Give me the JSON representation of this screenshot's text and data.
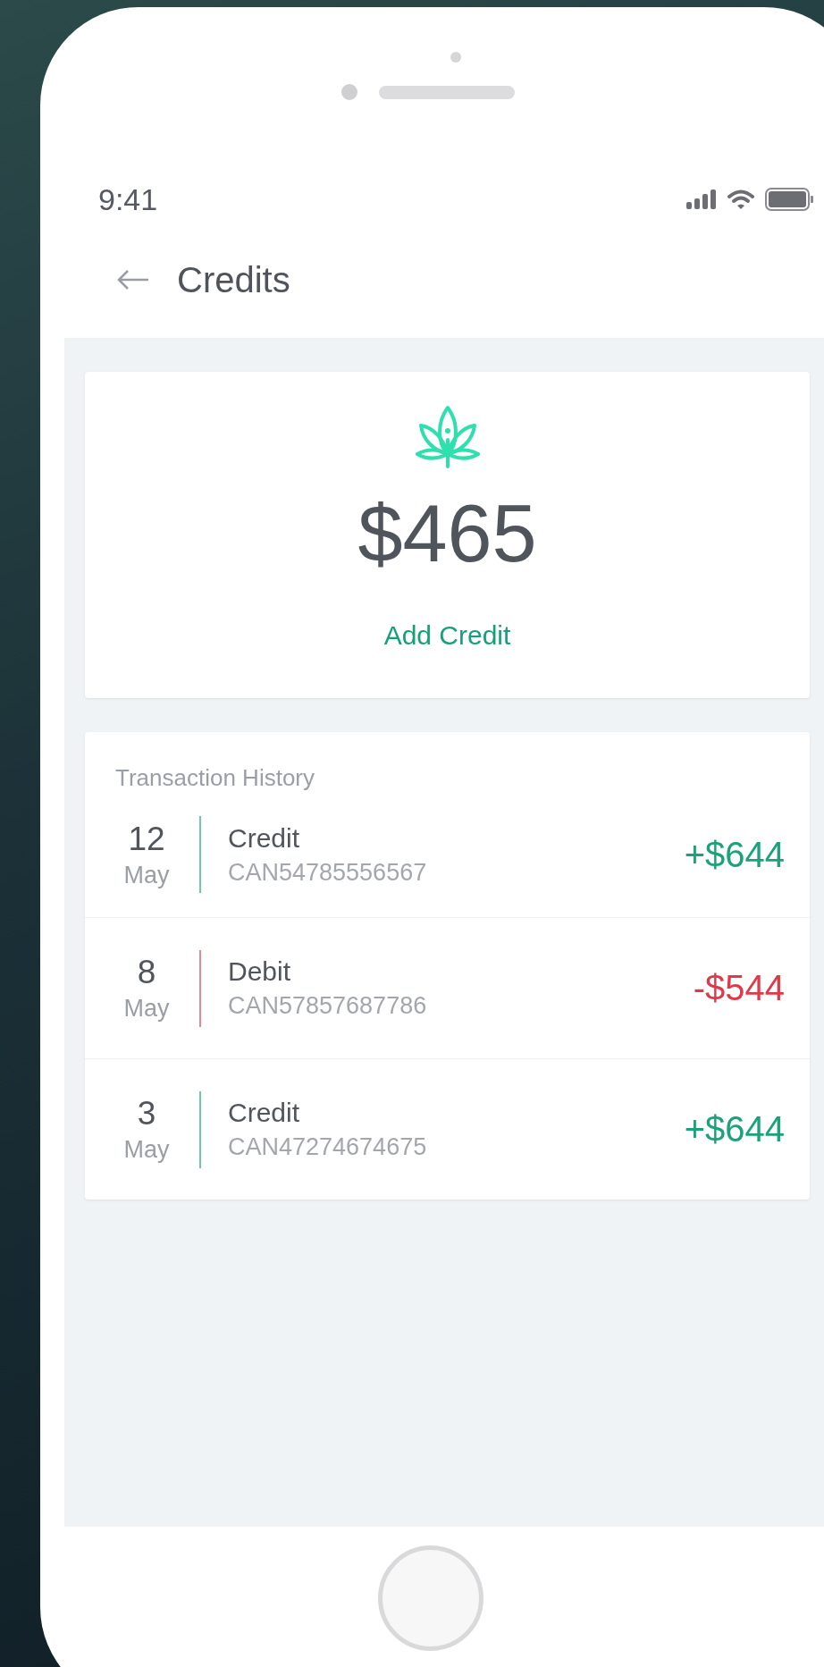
{
  "status_bar": {
    "time": "9:41"
  },
  "header": {
    "title": "Credits"
  },
  "balance": {
    "amount": "$465",
    "action": "Add Credit"
  },
  "history": {
    "title": "Transaction History",
    "transactions": [
      {
        "day": "12",
        "month": "May",
        "kind": "credit",
        "type": "Credit",
        "reference": "CAN54785556567",
        "amount": "+$644"
      },
      {
        "day": "8",
        "month": "May",
        "kind": "debit",
        "type": "Debit",
        "reference": "CAN57857687786",
        "amount": "-$544"
      },
      {
        "day": "3",
        "month": "May",
        "kind": "credit",
        "type": "Credit",
        "reference": "CAN47274674675",
        "amount": "+$644"
      }
    ]
  }
}
